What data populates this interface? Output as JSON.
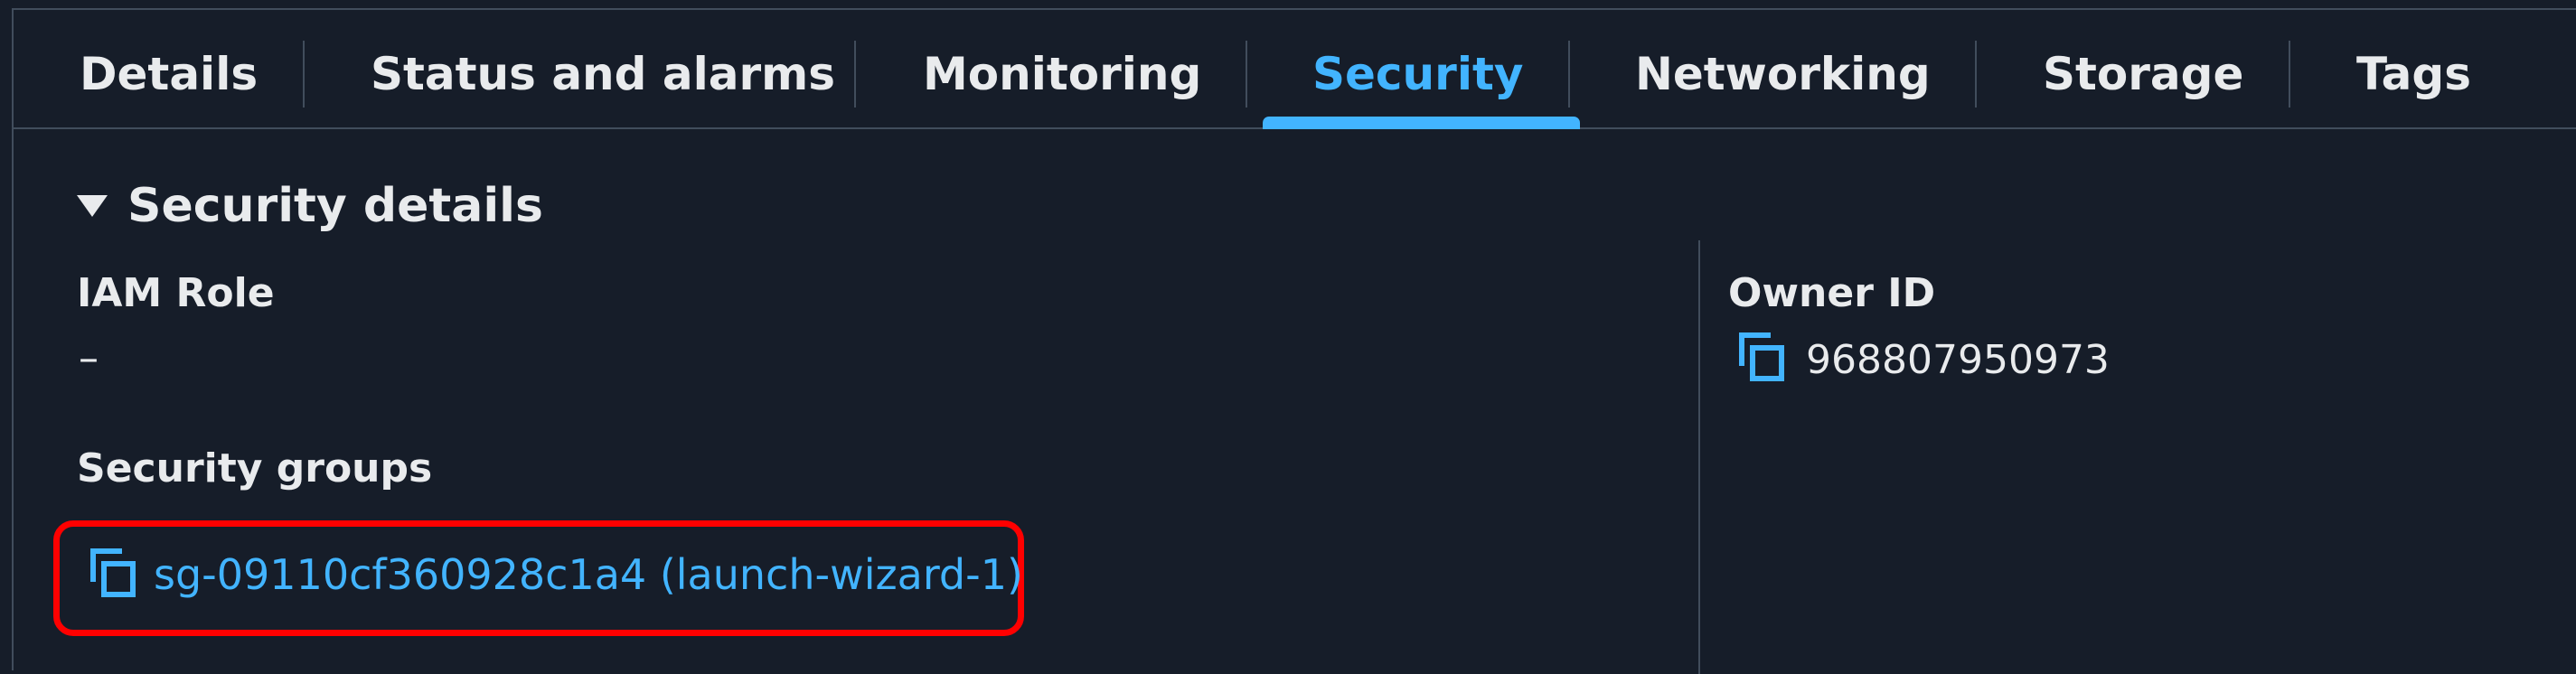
{
  "tabs": [
    {
      "label": "Details",
      "active": false
    },
    {
      "label": "Status and alarms",
      "active": false
    },
    {
      "label": "Monitoring",
      "active": false
    },
    {
      "label": "Security",
      "active": true
    },
    {
      "label": "Networking",
      "active": false
    },
    {
      "label": "Storage",
      "active": false
    },
    {
      "label": "Tags",
      "active": false
    }
  ],
  "section": {
    "title": "Security details",
    "expanded": true
  },
  "iam_role": {
    "label": "IAM Role",
    "value": "–"
  },
  "security_groups": {
    "label": "Security groups",
    "link_text": "sg-09110cf360928c1a4 (launch-wizard-1)"
  },
  "owner": {
    "label": "Owner ID",
    "value": "968807950973"
  },
  "colors": {
    "background": "#161d29",
    "text": "#e9ebed",
    "accent": "#42b4ff",
    "divider": "#414d5c",
    "highlight": "#ff0000"
  },
  "icons": {
    "copy": "copy-icon",
    "caret": "caret-down-icon"
  }
}
